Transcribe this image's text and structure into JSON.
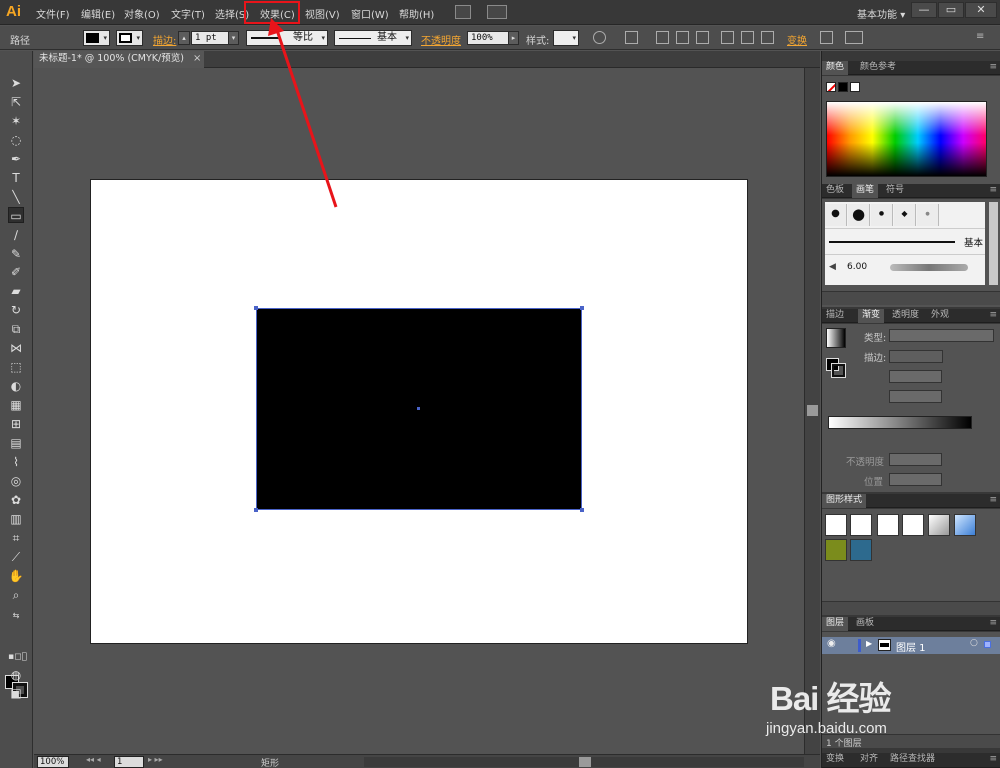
{
  "app": {
    "logo": "Ai",
    "menus": [
      "文件(F)",
      "编辑(E)",
      "对象(O)",
      "文字(T)",
      "选择(S)",
      "效果(C)",
      "视图(V)",
      "窗口(W)",
      "帮助(H)"
    ],
    "workspace": "基本功能",
    "workspace_arrow": "▾",
    "window_minimize": "—",
    "window_restore": "▭",
    "window_close": "✕"
  },
  "control": {
    "object_type": "路径",
    "stroke_label": "描边:",
    "stroke_weight": "1 pt",
    "stroke_profile": "等比",
    "brush_def": "基本",
    "opacity_label": "不透明度",
    "opacity_value": "100%",
    "style_label": "样式:",
    "transform_label": "变换"
  },
  "document": {
    "tab_title": "未标题-1* @ 100% (CMYK/预览)",
    "tab_close": "×",
    "zoom": "100%",
    "artboard_number": "1",
    "status_text": "矩形"
  },
  "panels": {
    "color": {
      "tabs": [
        "颜色",
        "颜色参考"
      ]
    },
    "brushes": {
      "tabs": [
        "色板",
        "画笔",
        "符号"
      ],
      "brush_row_label": "基本",
      "brush_size": "6.00"
    },
    "gradient": {
      "tabs": [
        "描边",
        "渐变",
        "透明度",
        "外观"
      ],
      "type_label": "类型:",
      "stroke_label": "描边:",
      "opacity_label": "不透明度",
      "position_label": "位置"
    },
    "graphic_styles": {
      "tabs": [
        "图形样式"
      ]
    },
    "layers": {
      "tabs": [
        "图层",
        "画板"
      ],
      "layer_name": "图层 1",
      "footer_count": "1 个图层"
    },
    "bottom_tabs": [
      "变换",
      "对齐",
      "路径查找器"
    ]
  },
  "watermark": {
    "brand": "Bai 经验",
    "site": "jingyan.baidu.com"
  },
  "colors": {
    "highlight": "#e8141a",
    "accent_orange": "#f4a631",
    "selection_blue": "#4a63c8"
  }
}
